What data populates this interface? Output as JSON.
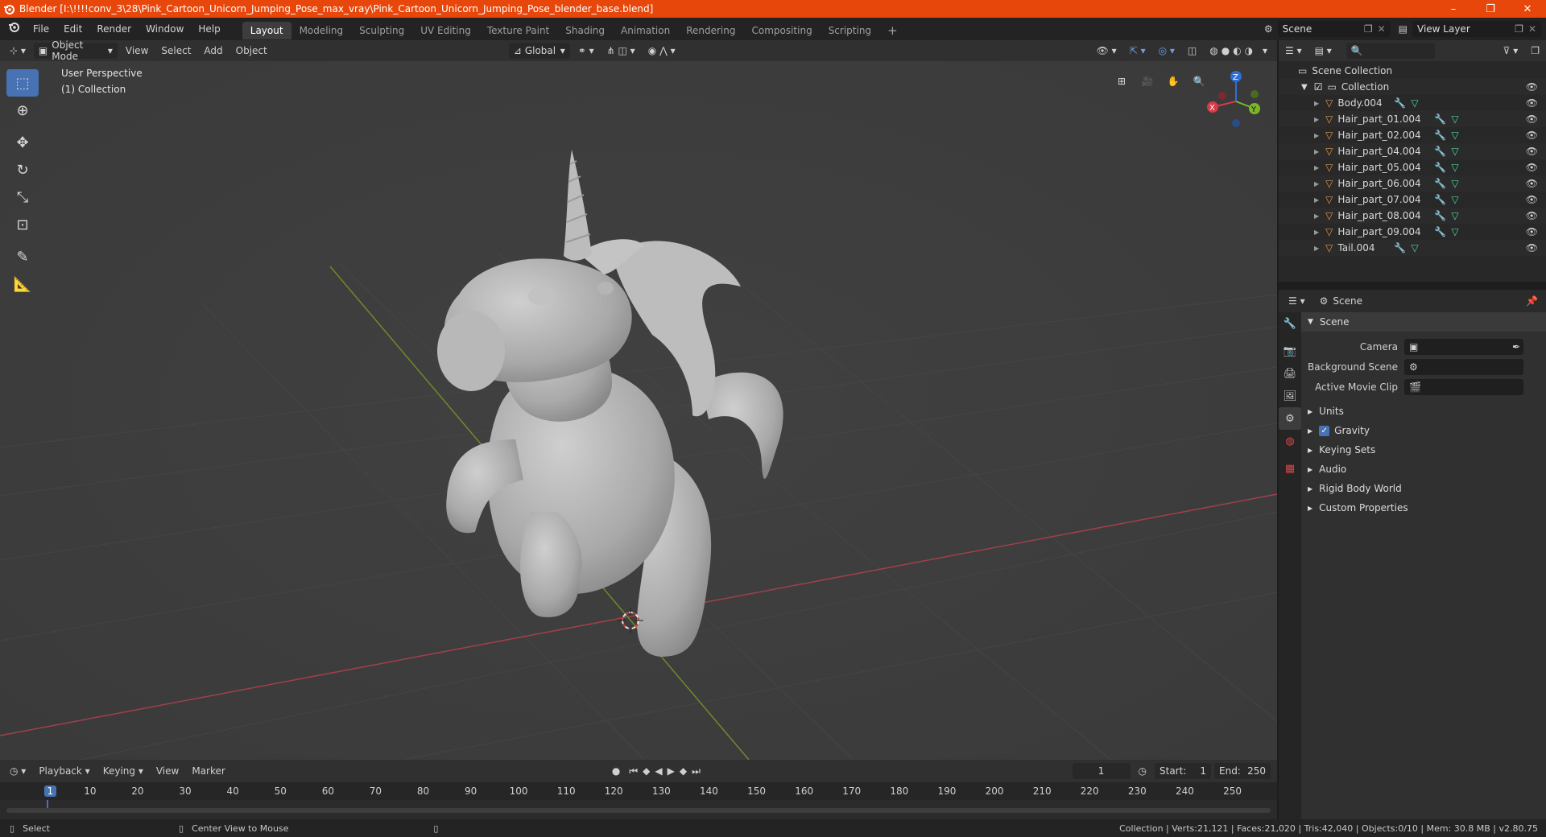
{
  "window": {
    "title": "Blender [I:\\!!!!conv_3\\28\\Pink_Cartoon_Unicorn_Jumping_Pose_max_vray\\Pink_Cartoon_Unicorn_Jumping_Pose_blender_base.blend]",
    "controls": [
      "–",
      "❐",
      "✕"
    ]
  },
  "menu": [
    "File",
    "Edit",
    "Render",
    "Window",
    "Help"
  ],
  "workspaces": [
    "Layout",
    "Modeling",
    "Sculpting",
    "UV Editing",
    "Texture Paint",
    "Shading",
    "Animation",
    "Rendering",
    "Compositing",
    "Scripting"
  ],
  "active_workspace": "Layout",
  "scene_name": "Scene",
  "view_layer": "View Layer",
  "viewport_header": {
    "mode": "Object Mode",
    "menus": [
      "View",
      "Select",
      "Add",
      "Object"
    ],
    "orientation": "Global"
  },
  "viewport": {
    "perspective": "User Perspective",
    "collection": "(1) Collection"
  },
  "gizmo": {
    "x": "X",
    "y": "Y",
    "z": "Z"
  },
  "outliner": {
    "root": "Scene Collection",
    "collection": "Collection",
    "objects": [
      "Body.004",
      "Hair_part_01.004",
      "Hair_part_02.004",
      "Hair_part_04.004",
      "Hair_part_05.004",
      "Hair_part_06.004",
      "Hair_part_07.004",
      "Hair_part_08.004",
      "Hair_part_09.004",
      "Tail.004"
    ]
  },
  "properties": {
    "header": "Scene",
    "panel": "Scene",
    "camera_label": "Camera",
    "bg_scene_label": "Background Scene",
    "movie_clip_label": "Active Movie Clip",
    "sections": [
      "Units",
      "Gravity",
      "Keying Sets",
      "Audio",
      "Rigid Body World",
      "Custom Properties"
    ]
  },
  "timeline": {
    "menus": [
      "Playback",
      "Keying",
      "View",
      "Marker"
    ],
    "current_frame": "1",
    "start_label": "Start:",
    "start": "1",
    "end_label": "End:",
    "end": "250",
    "ticks": [
      "1",
      "10",
      "20",
      "30",
      "40",
      "50",
      "60",
      "70",
      "80",
      "90",
      "100",
      "110",
      "120",
      "130",
      "140",
      "150",
      "160",
      "170",
      "180",
      "190",
      "200",
      "210",
      "220",
      "230",
      "240",
      "250"
    ]
  },
  "statusbar": {
    "select": "Select",
    "center": "Center View to Mouse",
    "stats": "Collection | Verts:21,121 | Faces:21,020 | Tris:42,040 | Objects:0/10 | Mem: 30.8 MB | v2.80.75"
  }
}
